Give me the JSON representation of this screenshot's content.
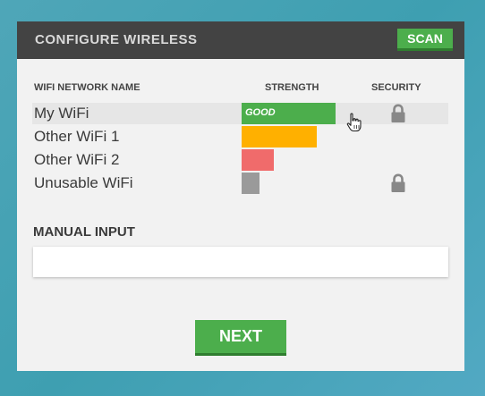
{
  "header": {
    "title": "CONFIGURE WIRELESS",
    "scan_label": "SCAN"
  },
  "table": {
    "columns": [
      "WIFI NETWORK NAME",
      "STRENGTH",
      "SECURITY"
    ],
    "rows": [
      {
        "name": "My WiFi",
        "strength_fraction": 0.74,
        "strength_label": "GOOD",
        "strength_color": "#4cae4c",
        "secured": true,
        "selected": true
      },
      {
        "name": "Other WiFi 1",
        "strength_fraction": 0.59,
        "strength_label": "",
        "strength_color": "#ffb000",
        "secured": false,
        "selected": false
      },
      {
        "name": "Other WiFi 2",
        "strength_fraction": 0.25,
        "strength_label": "",
        "strength_color": "#f06b6b",
        "secured": false,
        "selected": false
      },
      {
        "name": "Unusable WiFi",
        "strength_fraction": 0.14,
        "strength_label": "",
        "strength_color": "#9a9a9a",
        "secured": true,
        "selected": false
      }
    ]
  },
  "manual": {
    "label": "MANUAL INPUT",
    "value": "",
    "placeholder": ""
  },
  "footer": {
    "next_label": "NEXT"
  },
  "icons": {
    "lock": "lock-icon",
    "cursor": "hand-pointer-icon"
  },
  "colors": {
    "accent": "#4cae4c",
    "header_bg": "#434343",
    "panel_bg": "#f2f2f2"
  }
}
